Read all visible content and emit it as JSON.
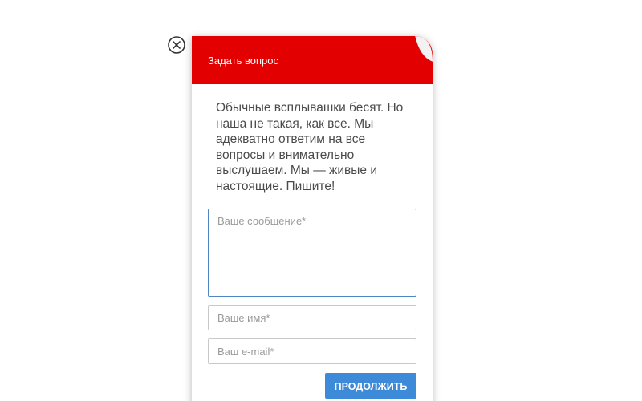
{
  "close": {
    "icon": "close-circle-icon"
  },
  "widget": {
    "title": "Задать вопрос",
    "intro": "Обычные всплывашки бесят. Но наша не такая, как все. Мы адекватно ответим на все вопросы и внимательно выслушаем. Мы — живые и настоящие. Пишите!",
    "header_color": "#e30000"
  },
  "form": {
    "message_placeholder": "Ваше сообщение*",
    "name_placeholder": "Ваше имя*",
    "email_placeholder": "Ваш e-mail*",
    "submit_label": "ПРОДОЛЖИТЬ",
    "submit_color": "#3c8ad8",
    "focus_color": "#4f86c6"
  }
}
